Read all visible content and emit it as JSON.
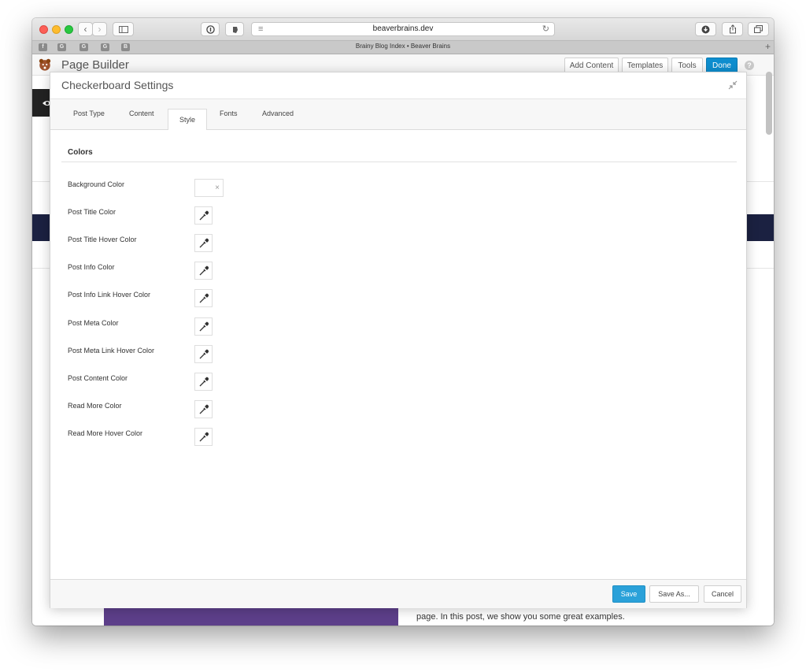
{
  "browser": {
    "url": "beaverbrains.dev",
    "tab_title": "Brainy Blog Index • Beaver Brains",
    "favicons": [
      "f",
      "G",
      "G",
      "G",
      "B"
    ]
  },
  "page_builder": {
    "title": "Page Builder",
    "buttons": {
      "add_content": "Add Content",
      "templates": "Templates",
      "tools": "Tools",
      "done": "Done",
      "help": "?"
    }
  },
  "background_page": {
    "text": "page. In this post, we show you some great examples."
  },
  "modal": {
    "title": "Checkerboard Settings",
    "tabs": [
      {
        "label": "Post Type"
      },
      {
        "label": "Content"
      },
      {
        "label": "Style",
        "active": true
      },
      {
        "label": "Fonts"
      },
      {
        "label": "Advanced"
      }
    ],
    "section_title": "Colors",
    "fields": [
      {
        "label": "Background Color"
      },
      {
        "label": "Post Title Color"
      },
      {
        "label": "Post Title Hover Color"
      },
      {
        "label": "Post Info Color"
      },
      {
        "label": "Post Info Link Hover Color"
      },
      {
        "label": "Post Meta Color"
      },
      {
        "label": "Post Meta Link Hover Color"
      },
      {
        "label": "Post Content Color"
      },
      {
        "label": "Read More Color"
      },
      {
        "label": "Read More Hover Color"
      }
    ],
    "footer": {
      "save": "Save",
      "save_as": "Save As...",
      "cancel": "Cancel"
    }
  },
  "colors": {
    "accent": "#2aa1d9",
    "done_button": "#0e8ecf",
    "navy_band": "#1b2141",
    "purple_block": "#5d3f8a"
  }
}
